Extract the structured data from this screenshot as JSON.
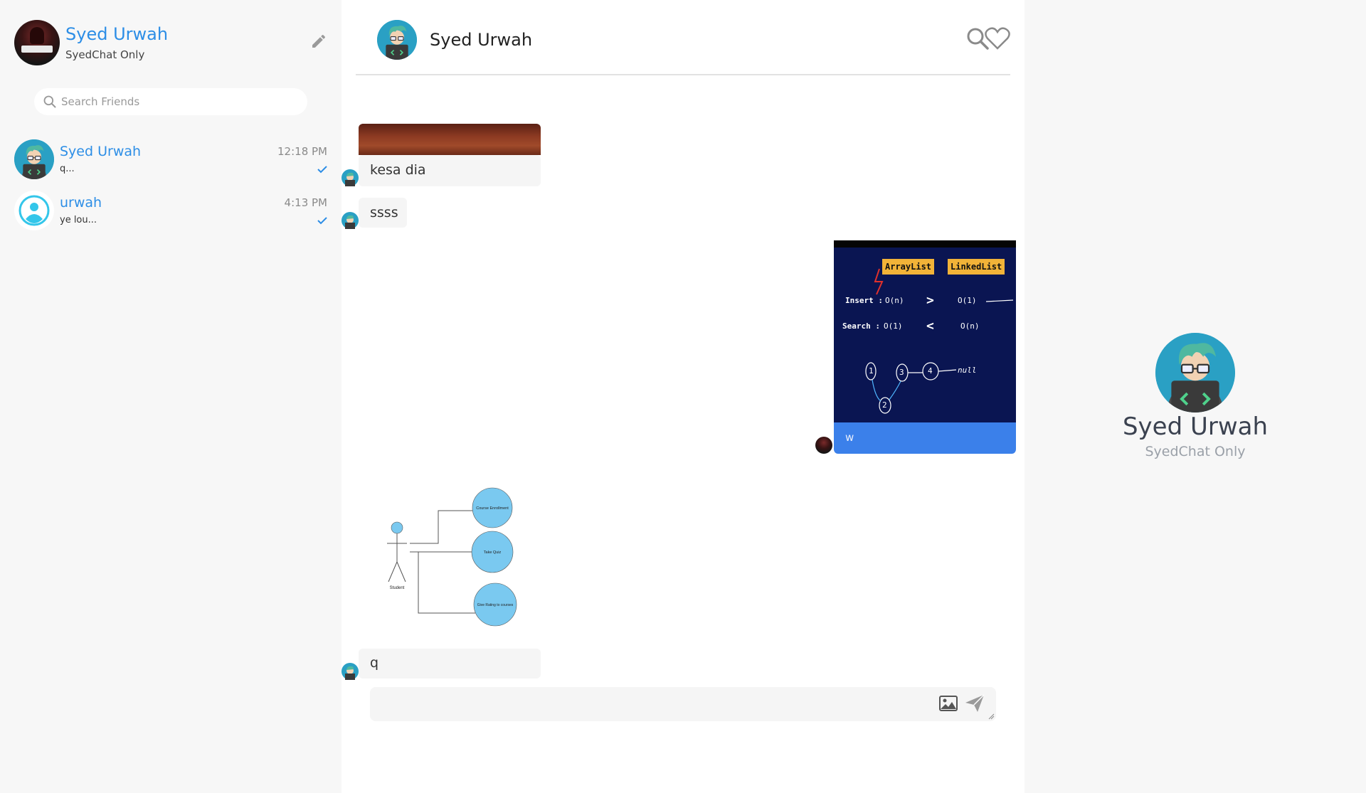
{
  "sidebar": {
    "profile": {
      "name": "Syed Urwah",
      "subtitle": "SyedChat Only"
    },
    "search": {
      "placeholder": "Search Friends"
    },
    "friends": [
      {
        "name": "Syed Urwah",
        "last_message": "q...",
        "time": "12:18 PM",
        "avatar": "coder-avatar"
      },
      {
        "name": "urwah",
        "last_message": "ye lou...",
        "time": "4:13 PM",
        "avatar": "default-user-avatar"
      }
    ]
  },
  "chat": {
    "header": {
      "name": "Syed Urwah"
    },
    "messages": [
      {
        "direction": "incoming",
        "type": "image+text",
        "text": "kesa dia"
      },
      {
        "direction": "incoming",
        "type": "text",
        "text": "ssss"
      },
      {
        "direction": "outgoing",
        "type": "image+text",
        "text": "w",
        "image_text": {
          "left_tag": "ArrayList",
          "right_tag": "LinkedList",
          "row1_label": "Insert :",
          "row1_left": "O(n)",
          "row1_op": ">",
          "row1_right": "O(1)",
          "row2_label": "Search :",
          "row2_left": "O(1)",
          "row2_op": "<",
          "row2_right": "O(n)",
          "list_nodes": [
            "1",
            "3",
            "4",
            "2"
          ],
          "list_end": "null"
        }
      },
      {
        "direction": "incoming",
        "type": "image",
        "image_text": {
          "actor": "Student",
          "use_cases": [
            "Course Enrollment",
            "Take Quiz",
            "Give Rating to courses"
          ]
        }
      },
      {
        "direction": "incoming",
        "type": "text",
        "text": "q"
      }
    ],
    "composer": {
      "value": ""
    }
  },
  "info_panel": {
    "name": "Syed Urwah",
    "subtitle": "SyedChat Only"
  },
  "colors": {
    "accent": "#2d8ee6",
    "outgoing_bubble": "#3b80ea",
    "avatar_bg": "#2aa0c4"
  }
}
